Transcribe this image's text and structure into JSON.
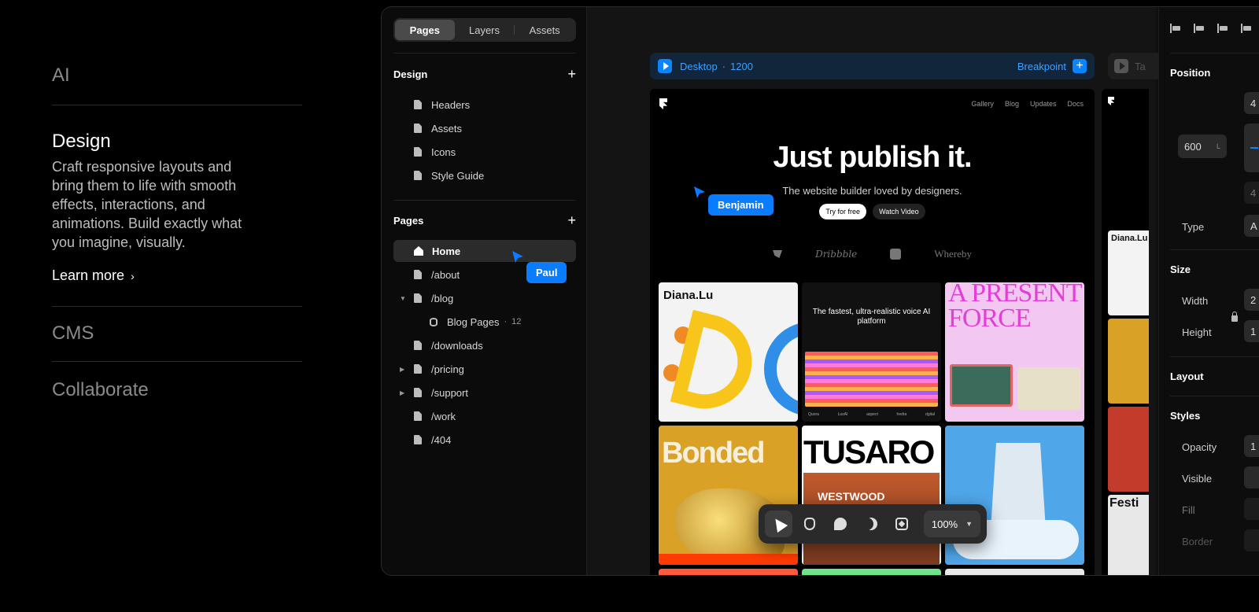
{
  "marketing": {
    "ai": "AI",
    "design_title": "Design",
    "design_desc": "Craft responsive layouts and bring them to life with smooth effects, interactions, and animations. Build exactly what you imagine, visually.",
    "learn_more": "Learn more",
    "learn_more_icon": "chevron-right-icon",
    "cms": "CMS",
    "collaborate": "Collaborate"
  },
  "sidebar": {
    "tabs": [
      "Pages",
      "Layers",
      "Assets"
    ],
    "active_tab": "Pages",
    "design_section": {
      "title": "Design",
      "add_icon": "plus-icon",
      "items": [
        "Headers",
        "Assets",
        "Icons",
        "Style Guide"
      ]
    },
    "pages_section": {
      "title": "Pages",
      "add_icon": "plus-icon",
      "items": [
        {
          "label": "Home",
          "icon": "home-icon",
          "selected": true
        },
        {
          "label": "/about",
          "icon": "page-icon"
        },
        {
          "label": "/blog",
          "icon": "page-icon",
          "expanded": true
        },
        {
          "label": "Blog Pages",
          "icon": "database-icon",
          "count": "12"
        },
        {
          "label": "/downloads",
          "icon": "page-icon"
        },
        {
          "label": "/pricing",
          "icon": "page-icon",
          "collapsed": true
        },
        {
          "label": "/support",
          "icon": "page-icon",
          "collapsed": true
        },
        {
          "label": "/work",
          "icon": "page-icon"
        },
        {
          "label": "/404",
          "icon": "page-icon"
        }
      ]
    }
  },
  "cursors": {
    "benjamin": "Benjamin",
    "paul": "Paul",
    "color": "#0A7CFF"
  },
  "canvas": {
    "breakpoint_name": "Desktop",
    "breakpoint_sep": "·",
    "breakpoint_width": "1200",
    "breakpoint_label": "Breakpoint",
    "second_breakpoint": "Ta",
    "site": {
      "nav": [
        "Gallery",
        "Blog",
        "Updates",
        "Docs"
      ],
      "hero_title": "Just publish it.",
      "hero_sub": "The website builder loved by designers.",
      "primary_cta": "Try for free",
      "secondary_cta": "Watch Video",
      "logos": [
        "Dribbble",
        "Whereby"
      ],
      "tiles": {
        "t1_title": "Diana.Lu",
        "t2_title": "The fastest, ultra-realistic voice AI platform",
        "t2_footer": [
          "Quora",
          "LuxAI",
          "aspect",
          "hedra",
          "dgital"
        ],
        "t3_title": "A PRESENT FORCE",
        "t4_title": "Bonded",
        "t5_title": "TUSARO",
        "t5_sub": "WESTWOOD"
      }
    },
    "preview2": {
      "tile_text_1": "Diana.Lu",
      "tile_text_2": "Festi"
    }
  },
  "toolbar": {
    "tools": [
      "pointer-icon",
      "hand-icon",
      "comment-icon",
      "theme-icon",
      "component-icon"
    ],
    "zoom": "100%"
  },
  "properties": {
    "position": "Position",
    "position_value": "600",
    "position_unit": "L",
    "type_label": "Type",
    "size": "Size",
    "width_label": "Width",
    "height_label": "Height",
    "layout": "Layout",
    "styles": "Styles",
    "opacity_label": "Opacity",
    "visible_label": "Visible",
    "fill_label": "Fill",
    "border_label": "Border",
    "field_values": {
      "top": "4",
      "bottom": "4",
      "type": "A",
      "width": "2",
      "height": "1",
      "opacity": "1"
    }
  }
}
